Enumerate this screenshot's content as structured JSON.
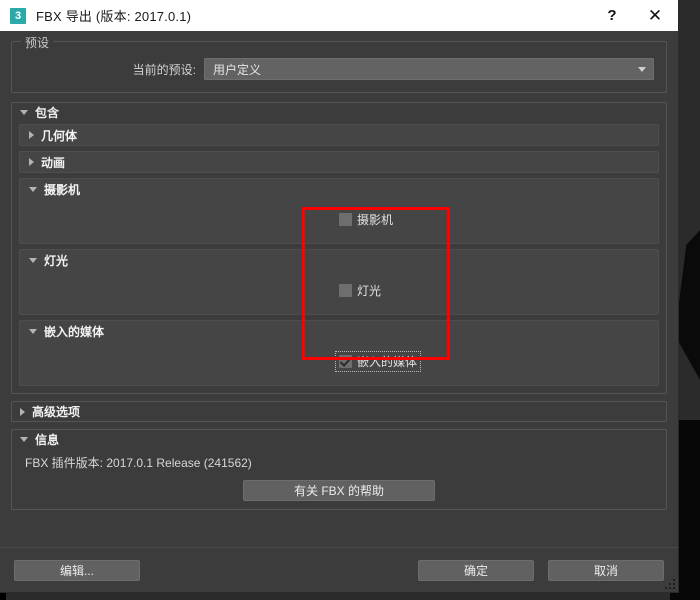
{
  "window": {
    "icon_label": "3",
    "icon_name": "max-3-icon",
    "title": "FBX 导出 (版本: 2017.0.1)",
    "help_button": "?",
    "close_button": "✕"
  },
  "preset_group": {
    "title": "预设",
    "current_preset_label": "当前的预设:",
    "current_preset_value": "用户定义",
    "dropdown_arrow": "▼"
  },
  "include_panel": {
    "title": "包含",
    "expanded": true,
    "sections": [
      {
        "title": "几何体",
        "expanded": false,
        "checkbox": null
      },
      {
        "title": "动画",
        "expanded": false,
        "checkbox": null
      },
      {
        "title": "摄影机",
        "expanded": true,
        "checkbox": {
          "label": "摄影机",
          "checked": false,
          "focused": false
        }
      },
      {
        "title": "灯光",
        "expanded": true,
        "checkbox": {
          "label": "灯光",
          "checked": false,
          "focused": false
        }
      },
      {
        "title": "嵌入的媒体",
        "expanded": true,
        "checkbox": {
          "label": "嵌入的媒体",
          "checked": true,
          "focused": true
        }
      }
    ]
  },
  "advanced_panel": {
    "title": "高级选项",
    "expanded": false
  },
  "info_panel": {
    "title": "信息",
    "expanded": true,
    "version_text": "FBX 插件版本: 2017.0.1 Release (241562)",
    "help_button_label": "有关 FBX 的帮助"
  },
  "footer": {
    "edit_label": "编辑...",
    "ok_label": "确定",
    "cancel_label": "取消"
  },
  "annotation": {
    "color": "#ff0000",
    "shape": "rectangle"
  }
}
